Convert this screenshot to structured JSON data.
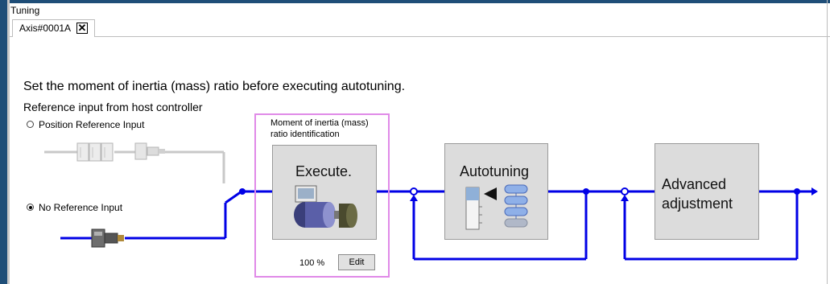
{
  "window": {
    "title": "Tuning"
  },
  "tabs": [
    {
      "label": "Axis#0001A",
      "close_glyph": "✕"
    }
  ],
  "instruction": "Set the moment of inertia (mass) ratio before executing autotuning.",
  "reference_heading": "Reference input from host controller",
  "reference_options": [
    {
      "label": "Position Reference Input",
      "selected": false
    },
    {
      "label": "No Reference Input",
      "selected": true
    }
  ],
  "inertia_step": {
    "label_line1": "Moment of inertia (mass)",
    "label_line2": "ratio identification",
    "execute_label": "Execute.",
    "percent_text": "100 %",
    "edit_label": "Edit"
  },
  "autotuning_step": {
    "label": "Autotuning"
  },
  "advanced_step": {
    "label_line1": "Advanced",
    "label_line2": "adjustment"
  },
  "colors": {
    "flow_line": "#0000e6",
    "highlight": "#e08ae8",
    "box_fill": "#dcdcdc",
    "inactive_line": "#c8c8c8",
    "left_strip": "#1f4e78"
  }
}
